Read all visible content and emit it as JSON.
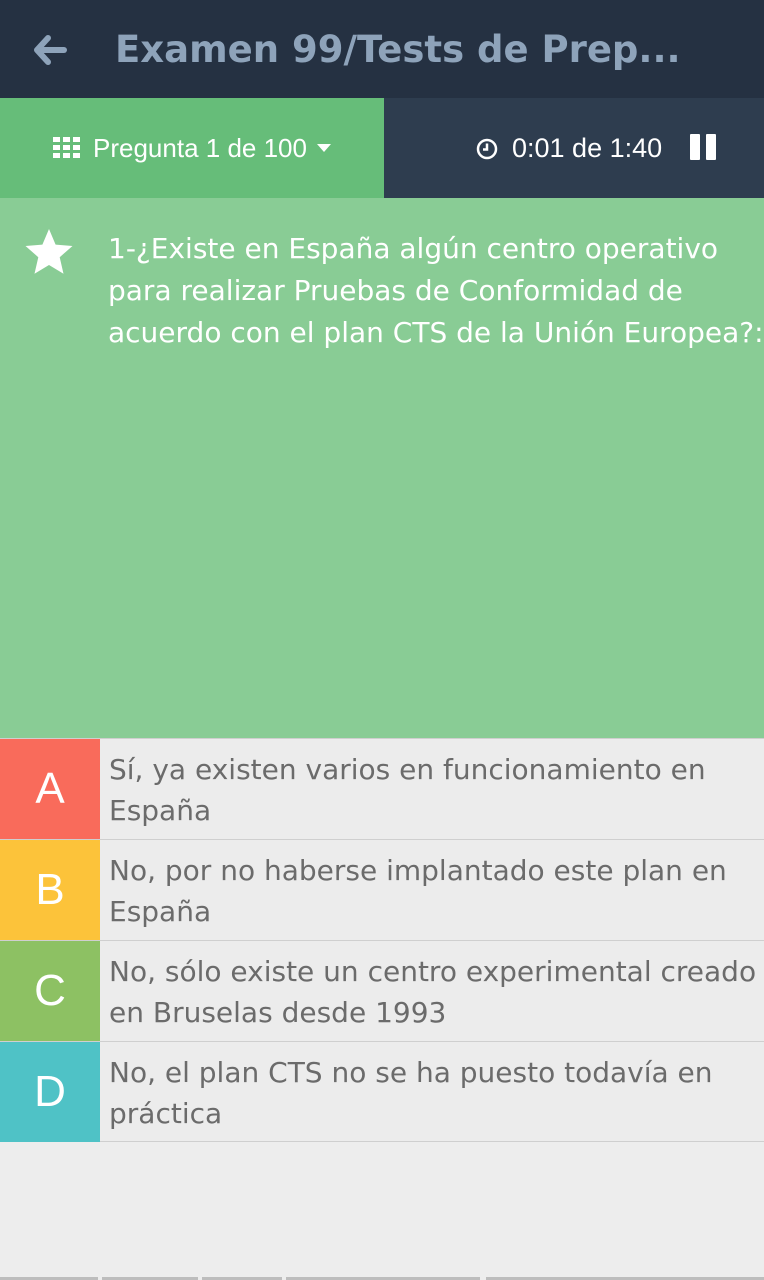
{
  "appbar": {
    "title": "Examen 99/Tests de Prep...",
    "back_icon": "arrow-left-icon"
  },
  "subbar": {
    "question_nav_label": "Pregunta 1 de 100",
    "timer_text": "0:01 de 1:40"
  },
  "question": {
    "text": "1-¿Existe en España algún centro operativo para realizar Pruebas de Conformidad de acuerdo con el plan CTS de la Unión Europea?:"
  },
  "answers": [
    {
      "letter": "A",
      "text": "Sí, ya existen varios en funcionamiento en España",
      "color": "#f96b5b"
    },
    {
      "letter": "B",
      "text": "No, por no haberse implantado este plan en España",
      "color": "#fcc33a"
    },
    {
      "letter": "C",
      "text": "No, sólo existe un centro experimental creado en Bruselas desde 1993",
      "color": "#8dc163"
    },
    {
      "letter": "D",
      "text": "No, el plan CTS no se ha puesto todavía en práctica",
      "color": "#4fc2c6"
    }
  ],
  "colors": {
    "appbar_bg": "#253142",
    "title_color": "#8ea3ba",
    "nav_green": "#66bd79",
    "timer_bg": "#2e3d4f",
    "question_bg": "#89cc95"
  }
}
